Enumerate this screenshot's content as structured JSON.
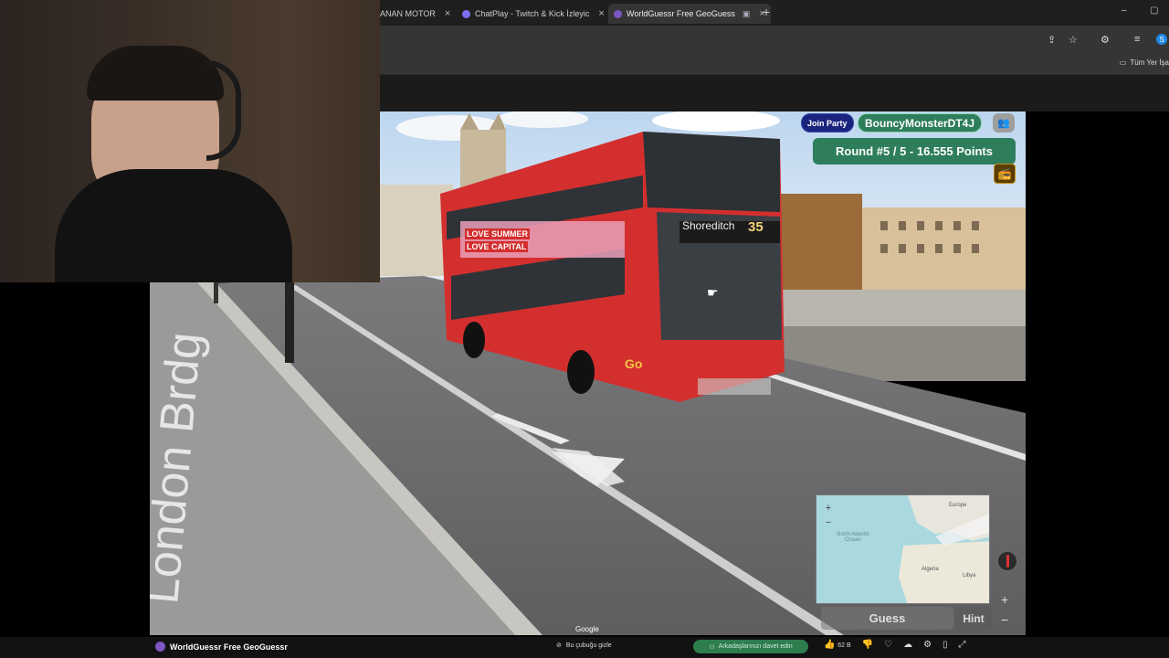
{
  "browser": {
    "tabs": [
      {
        "label": "ANAN MOTOR"
      },
      {
        "label": "ChatPlay - Twitch & Kick İzleyic"
      },
      {
        "label": "WorldGuessr Free GeoGuess"
      }
    ],
    "new_tab": "+",
    "bookmarks_folder": "Tüm Yer İşa",
    "window_controls": {
      "minimize": "–",
      "maximize": "▢"
    }
  },
  "game": {
    "join_party": "Join Party",
    "username": "BouncyMonsterDT4J",
    "round_info": "Round #5 / 5 - 16.555 Points",
    "guess_label": "Guess",
    "hint_label": "Hint",
    "google_label": "Google",
    "map_zoom_in": "+",
    "map_zoom_out": "−",
    "side_zoom_in": "+",
    "side_zoom_out": "−",
    "map_labels": {
      "atlantic": "North Atlantic Ocean",
      "algeria": "Algeria",
      "libya": "Libya",
      "europe": "Europe"
    }
  },
  "scene": {
    "bus_destination": "Shoreditch",
    "bus_route": "35",
    "bus_ad_line1": "LOVE SUMMER",
    "bus_ad_line2": "LOVE CAPITAL",
    "bus_logo": "Go",
    "road_marking": "London Brdg"
  },
  "bottom": {
    "app_title": "WorldGuessr Free GeoGuessr",
    "hide_bar": "Bu çubuğu gizle",
    "invite_friends": "Arkadaşlarınızı davet edin",
    "likes": "62 B"
  },
  "colors": {
    "accent_green": "#2e7d5b",
    "party_blue": "#1a237e",
    "bus_red": "#d32f2f"
  }
}
